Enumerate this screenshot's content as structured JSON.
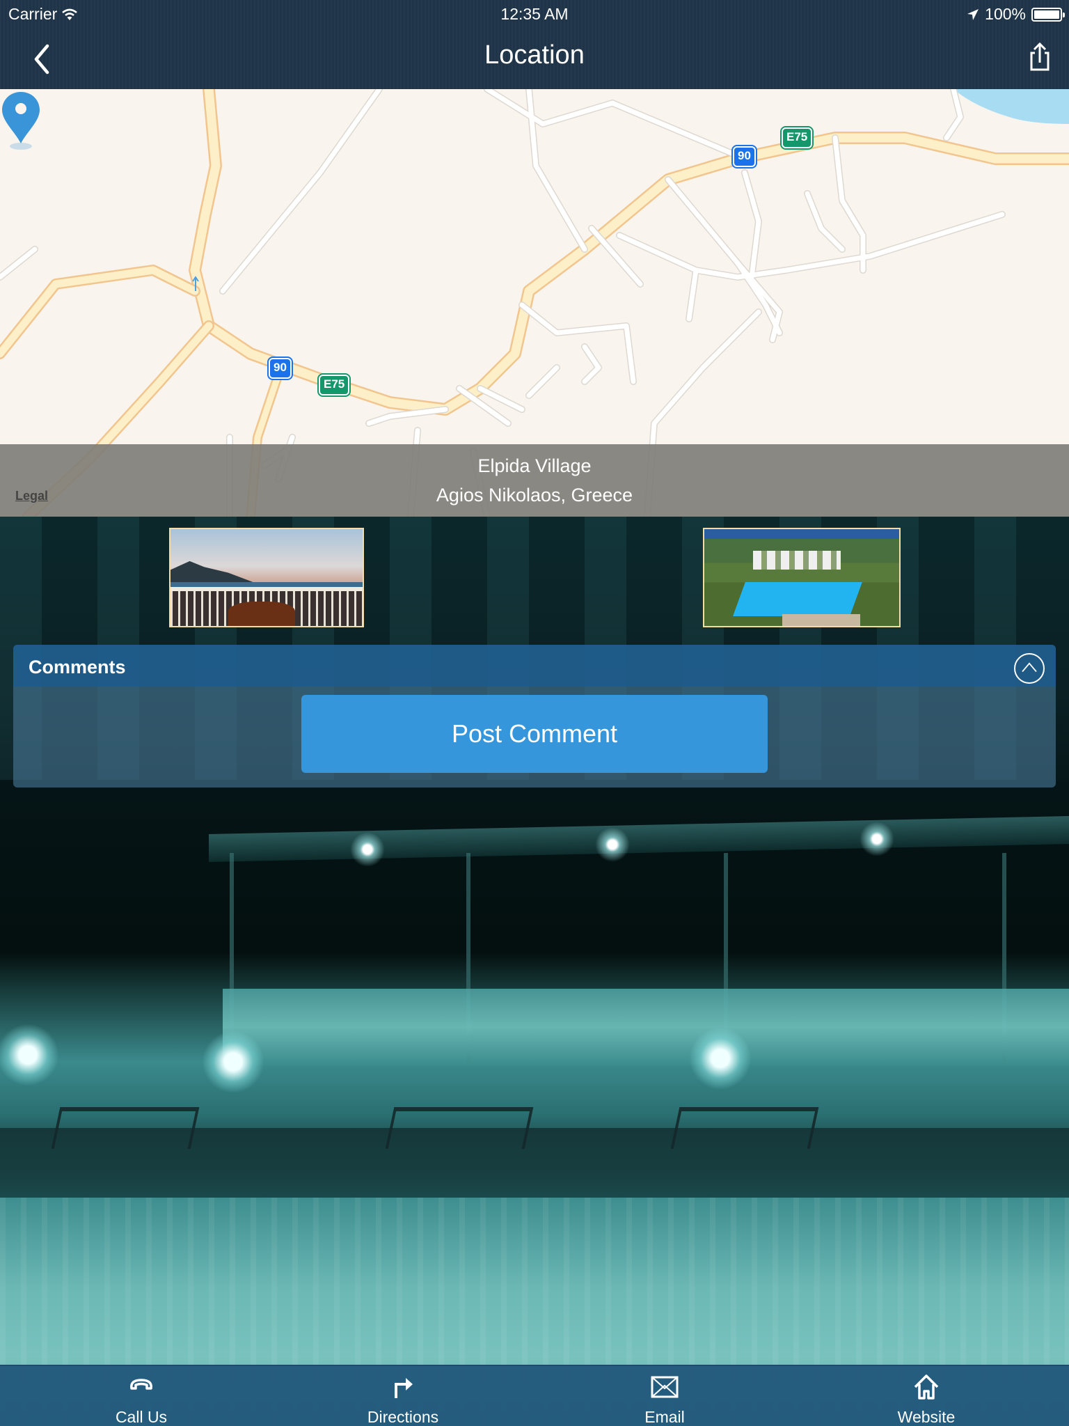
{
  "status_bar": {
    "carrier": "Carrier",
    "time": "12:35 AM",
    "battery": "100%"
  },
  "nav": {
    "title": "Location",
    "back_icon": "chevron-left-icon",
    "share_icon": "share-icon"
  },
  "map": {
    "route_shields": [
      {
        "label": "90",
        "color": "#1a73e8"
      },
      {
        "label": "E75",
        "color": "#14976b"
      },
      {
        "label": "90",
        "color": "#1a73e8"
      },
      {
        "label": "E75",
        "color": "#14976b"
      }
    ],
    "pin_color": "#3a95d8",
    "legal_label": "Legal",
    "place_name": "Elpida Village",
    "place_address": "Agios Nikolaos, Greece"
  },
  "gallery": {
    "images": [
      {
        "alt": "Balcony sea view at sunset"
      },
      {
        "alt": "Aerial view of resort pool"
      }
    ]
  },
  "comments": {
    "title": "Comments",
    "collapse_icon": "chevron-up-circle-icon",
    "post_button": "Post Comment",
    "accent": "#3696db"
  },
  "tab_bar": {
    "items": [
      {
        "label": "Call Us",
        "icon": "phone-icon"
      },
      {
        "label": "Directions",
        "icon": "directions-arrow-icon"
      },
      {
        "label": "Email",
        "icon": "envelope-icon"
      },
      {
        "label": "Website",
        "icon": "home-icon"
      }
    ]
  }
}
